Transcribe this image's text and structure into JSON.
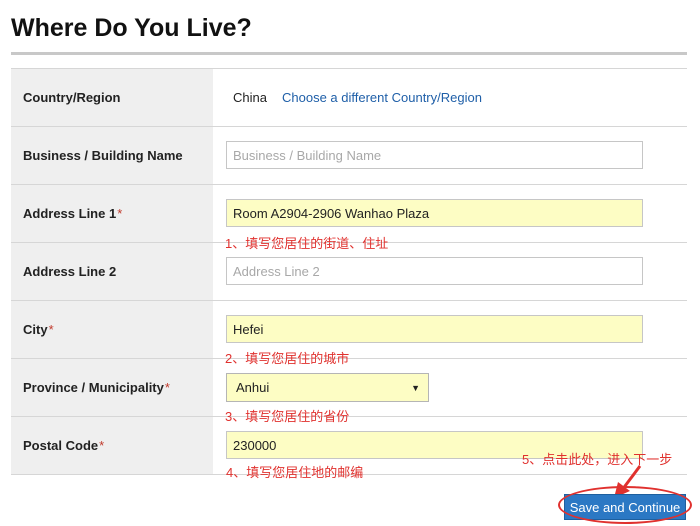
{
  "page": {
    "title": "Where Do You Live?"
  },
  "form": {
    "country": {
      "label": "Country/Region",
      "value": "China",
      "change_link": "Choose a different Country/Region"
    },
    "business": {
      "label": "Business / Building Name",
      "value": "",
      "placeholder": "Business / Building Name"
    },
    "address1": {
      "label": "Address Line 1",
      "required_mark": "*",
      "value": "Room A2904-2906 Wanhao Plaza",
      "placeholder": ""
    },
    "address2": {
      "label": "Address Line 2",
      "value": "",
      "placeholder": "Address Line 2"
    },
    "city": {
      "label": "City",
      "required_mark": "*",
      "value": "Hefei",
      "placeholder": ""
    },
    "province": {
      "label": "Province / Municipality",
      "required_mark": "*",
      "selected": "Anhui"
    },
    "postal": {
      "label": "Postal Code",
      "required_mark": "*",
      "value": "230000",
      "placeholder": ""
    }
  },
  "annotations": {
    "note1": "1、填写您居住的街道、住址",
    "note2": "2、填写您居住的城市",
    "note3": "3、填写您居住的省份",
    "note4": "4、填写您居住地的邮编",
    "note5": "5、点击此处，进入下一步"
  },
  "actions": {
    "save_label": "Save and Continue"
  },
  "colors": {
    "accent": "#2b78c4",
    "filled_bg": "#fdfdc4",
    "annotation": "#e0312e",
    "link": "#1f5fa8"
  }
}
